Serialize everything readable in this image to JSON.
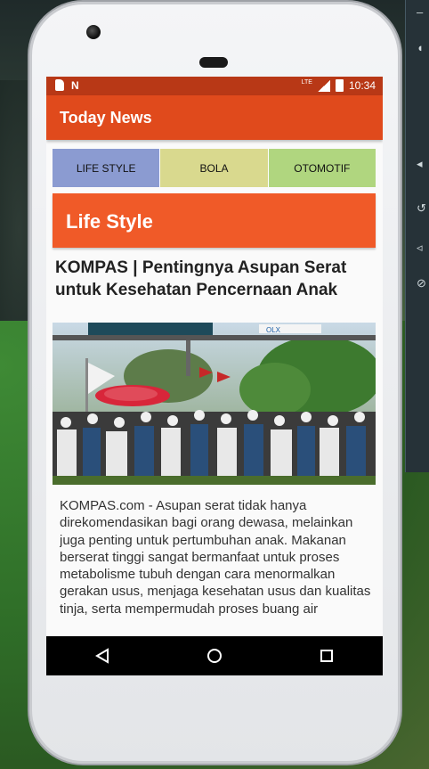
{
  "status_bar": {
    "network": "LTE",
    "time": "10:34"
  },
  "app_bar": {
    "title": "Today News"
  },
  "tabs": [
    {
      "label": "LIFE STYLE",
      "color": "#8b9bd1"
    },
    {
      "label": "BOLA",
      "color": "#d9d98e"
    },
    {
      "label": "OTOMOTIF",
      "color": "#b0d67f"
    }
  ],
  "section": {
    "title": "Life Style",
    "color": "#f05a28"
  },
  "article": {
    "headline": "KOMPAS | Pentingnya Asupan Serat untuk Kesehatan Pencernaan Anak",
    "image_banner_text": "OLX",
    "body": "KOMPAS.com - Asupan serat tidak hanya direkomendasikan bagi orang dewasa, melainkan juga penting untuk pertumbuhan anak. Makanan berserat tinggi sangat bermanfaat untuk proses metabolisme tubuh dengan cara menormalkan gerakan usus, menjaga kesehatan usus dan kualitas tinja, serta mempermudah proses buang air"
  },
  "icons": {
    "back": "back-triangle-icon",
    "home": "home-circle-icon",
    "recents": "recents-square-icon"
  },
  "colors": {
    "status_bar": "#b83816",
    "app_bar": "#e04a1c"
  }
}
